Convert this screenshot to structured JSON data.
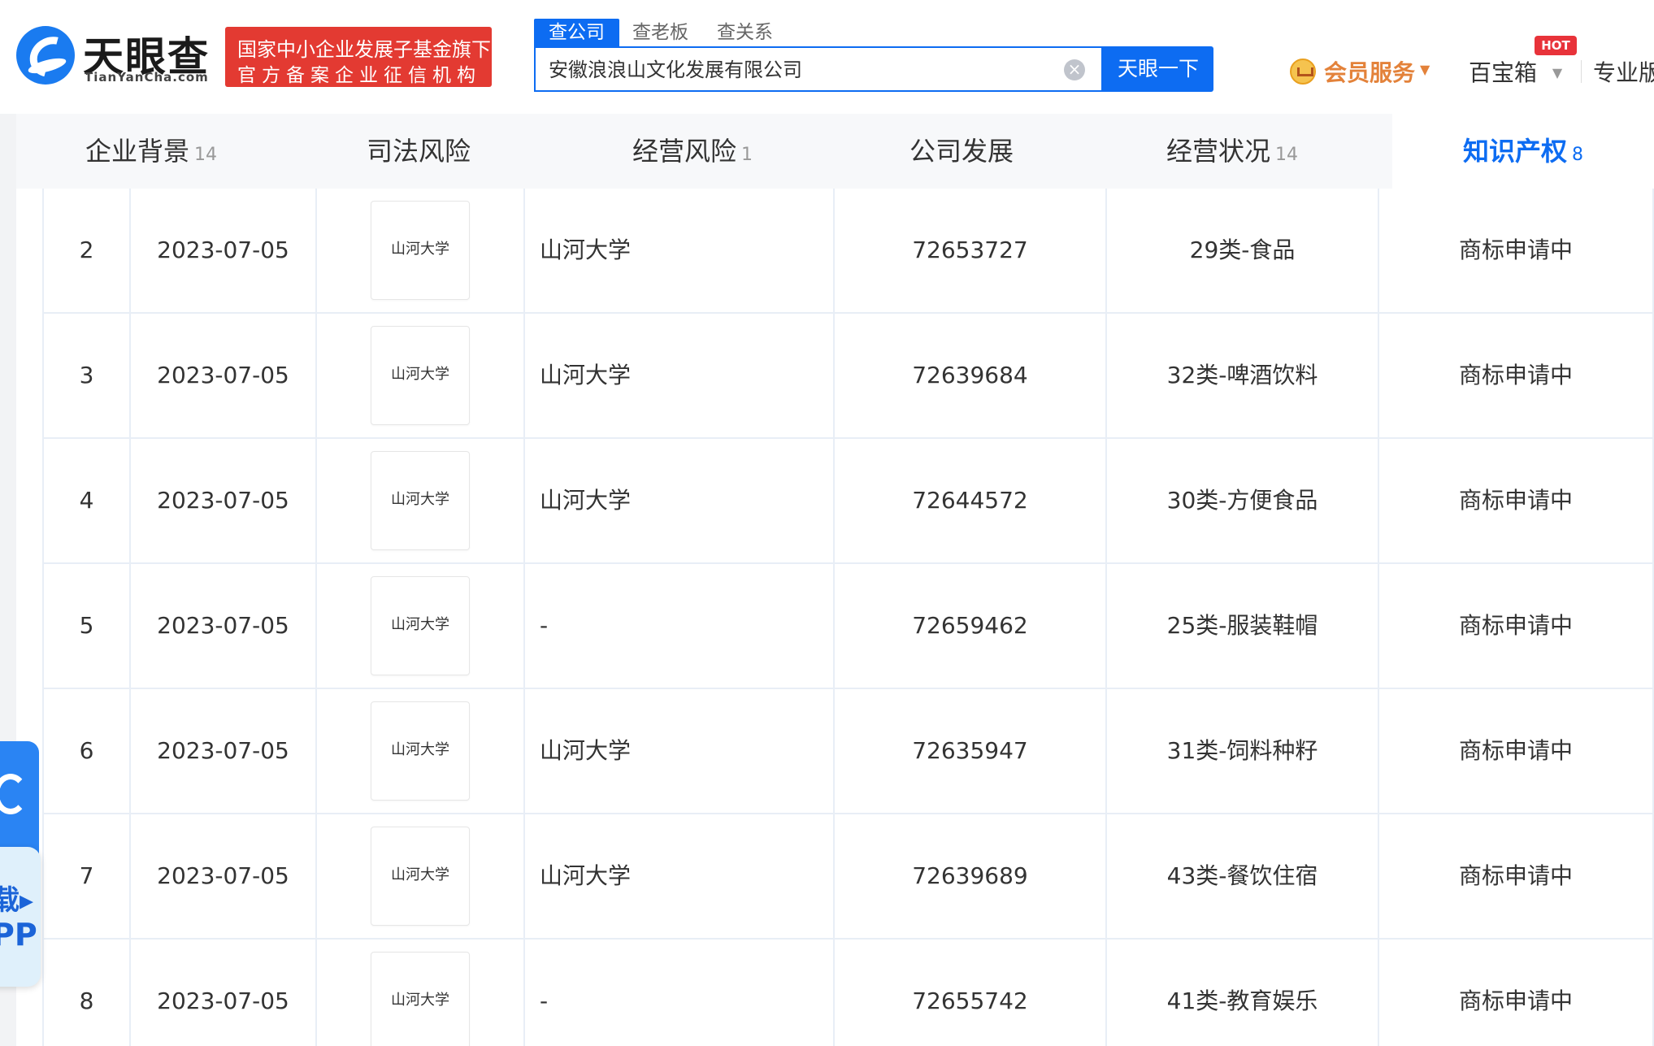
{
  "header": {
    "logo_text": "天眼查",
    "logo_sub": "TianYanCha.com",
    "gov_badge_line1": "国家中小企业发展子基金旗下",
    "gov_badge_line2": "官方备案企业征信机构",
    "search_tabs": [
      "查公司",
      "查老板",
      "查关系"
    ],
    "search_value": "安徽浪浪山文化发展有限公司",
    "search_button": "天眼一下",
    "vip_label": "会员服务",
    "baobox_label": "百宝箱",
    "hot_badge": "HOT",
    "pro_label": "专业版"
  },
  "nav": {
    "tabs": [
      {
        "label": "企业背景",
        "count": "14"
      },
      {
        "label": "司法风险",
        "count": ""
      },
      {
        "label": "经营风险",
        "count": "1"
      },
      {
        "label": "公司发展",
        "count": ""
      },
      {
        "label": "经营状况",
        "count": "14"
      },
      {
        "label": "知识产权",
        "count": "8"
      }
    ]
  },
  "table": {
    "rows": [
      {
        "index": "2",
        "date": "2023-07-05",
        "image_text": "山河大学",
        "name": "山河大学",
        "reg_no": "72653727",
        "class": "29类-食品",
        "status": "商标申请中"
      },
      {
        "index": "3",
        "date": "2023-07-05",
        "image_text": "山河大学",
        "name": "山河大学",
        "reg_no": "72639684",
        "class": "32类-啤酒饮料",
        "status": "商标申请中"
      },
      {
        "index": "4",
        "date": "2023-07-05",
        "image_text": "山河大学",
        "name": "山河大学",
        "reg_no": "72644572",
        "class": "30类-方便食品",
        "status": "商标申请中"
      },
      {
        "index": "5",
        "date": "2023-07-05",
        "image_text": "山河大学",
        "name": "-",
        "reg_no": "72659462",
        "class": "25类-服装鞋帽",
        "status": "商标申请中"
      },
      {
        "index": "6",
        "date": "2023-07-05",
        "image_text": "山河大学",
        "name": "山河大学",
        "reg_no": "72635947",
        "class": "31类-饲料种籽",
        "status": "商标申请中"
      },
      {
        "index": "7",
        "date": "2023-07-05",
        "image_text": "山河大学",
        "name": "山河大学",
        "reg_no": "72639689",
        "class": "43类-餐饮住宿",
        "status": "商标申请中"
      },
      {
        "index": "8",
        "date": "2023-07-05",
        "image_text": "山河大学",
        "name": "-",
        "reg_no": "72655742",
        "class": "41类-教育娱乐",
        "status": "商标申请中"
      }
    ]
  },
  "float_app": {
    "line1": "载▸",
    "line2": "PP"
  }
}
